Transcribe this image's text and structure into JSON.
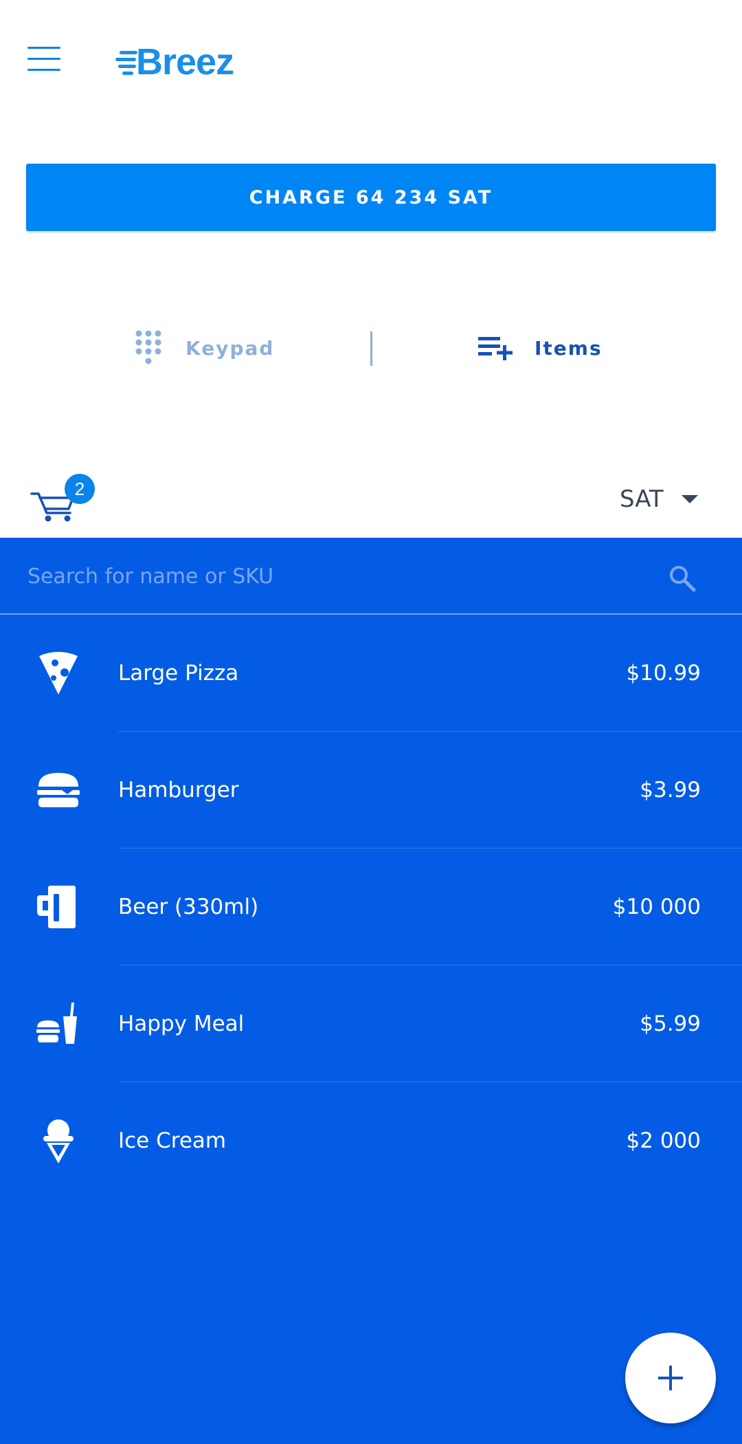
{
  "header": {
    "menu_icon": "hamburger-menu-icon",
    "logo_text": "Breez"
  },
  "charge": {
    "label": "CHARGE 64 234 SAT"
  },
  "tabs": [
    {
      "label": "Keypad",
      "icon": "dialpad-icon",
      "active": false
    },
    {
      "label": "Items",
      "icon": "playlist-add-icon",
      "active": true
    }
  ],
  "cart": {
    "icon": "shopping-cart-icon",
    "count": "2"
  },
  "currency": {
    "selected": "SAT"
  },
  "search": {
    "placeholder": "Search for name or SKU",
    "value": ""
  },
  "items": [
    {
      "name": "Large Pizza",
      "price": "$10.99",
      "icon": "pizza-icon"
    },
    {
      "name": "Hamburger",
      "price": "$3.99",
      "icon": "hamburger-icon"
    },
    {
      "name": "Beer (330ml)",
      "price": "$10 000",
      "icon": "beer-mug-icon"
    },
    {
      "name": "Happy Meal",
      "price": "$5.99",
      "icon": "happy-meal-icon"
    },
    {
      "name": "Ice Cream",
      "price": "$2 000",
      "icon": "ice-cream-icon"
    }
  ],
  "colors": {
    "brand": "#0085f5",
    "panel": "#055ce4",
    "active_tab": "#1552b5",
    "inactive_tab": "#8fb0d8"
  },
  "fab": {
    "icon": "plus-icon"
  }
}
